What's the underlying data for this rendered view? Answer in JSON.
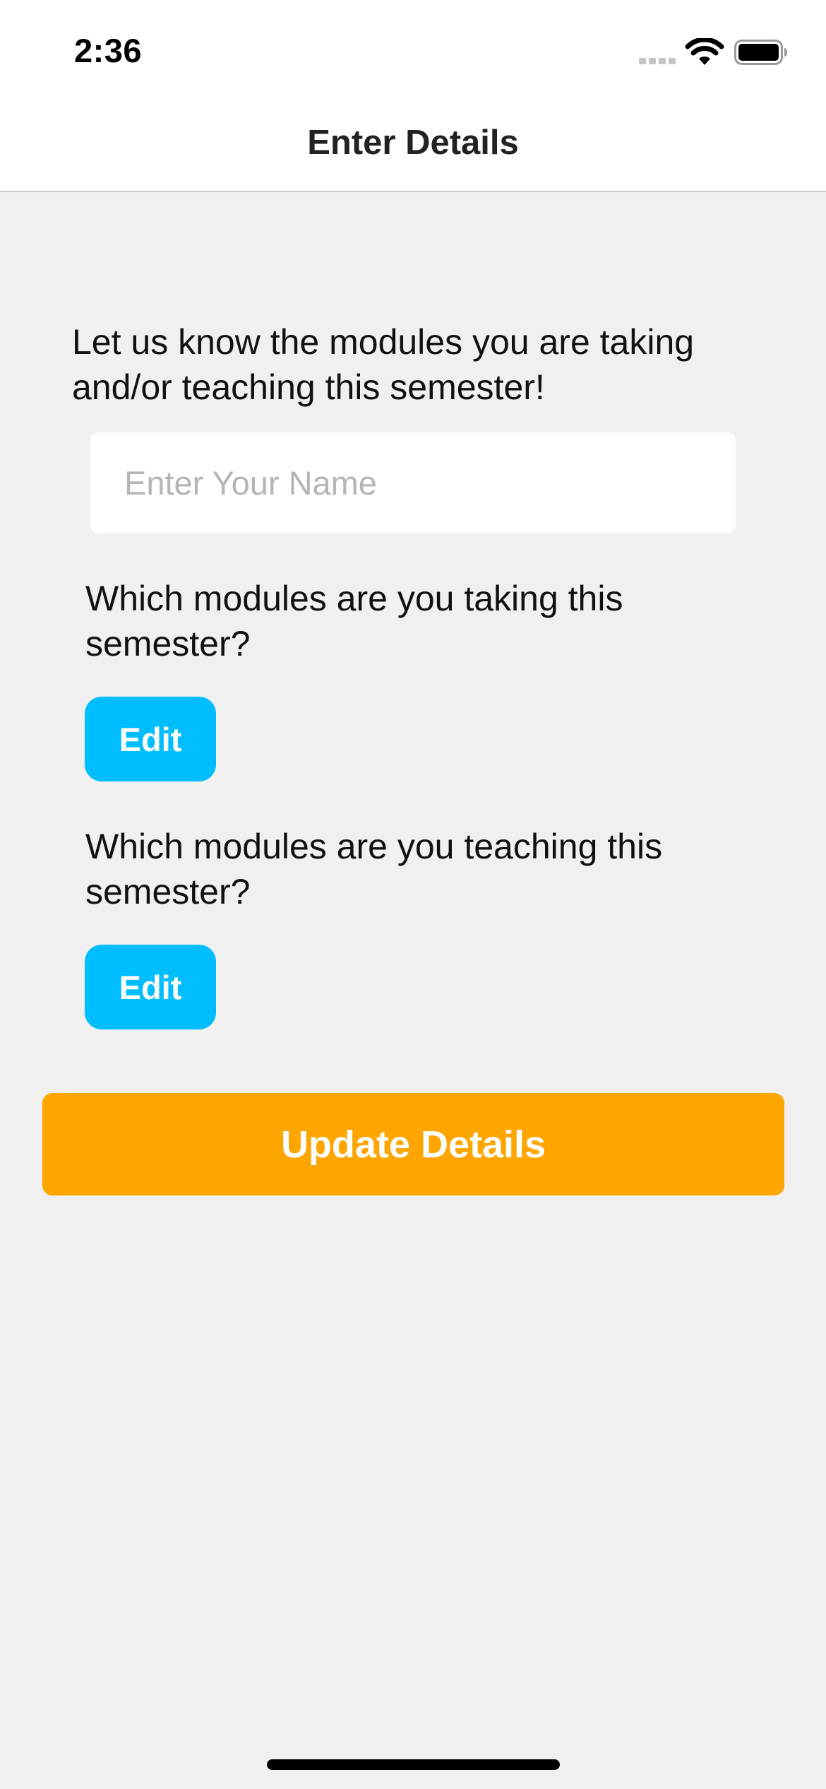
{
  "status_bar": {
    "time": "2:36",
    "icons": [
      "signal-icon",
      "wifi-icon",
      "battery-icon"
    ]
  },
  "nav": {
    "title": "Enter Details"
  },
  "form": {
    "intro": "Let us know the modules you are taking and/or teaching this semester!",
    "name_field": {
      "value": "",
      "placeholder": "Enter Your Name"
    },
    "taking": {
      "question": "Which modules are you taking this semester?",
      "edit_label": "Edit"
    },
    "teaching": {
      "question": "Which modules are you teaching this semester?",
      "edit_label": "Edit"
    },
    "update_label": "Update Details"
  },
  "colors": {
    "background": "#f0f0f0",
    "edit_button": "#00bdff",
    "update_button": "#ffa500",
    "bar_background": "#ffffff"
  }
}
